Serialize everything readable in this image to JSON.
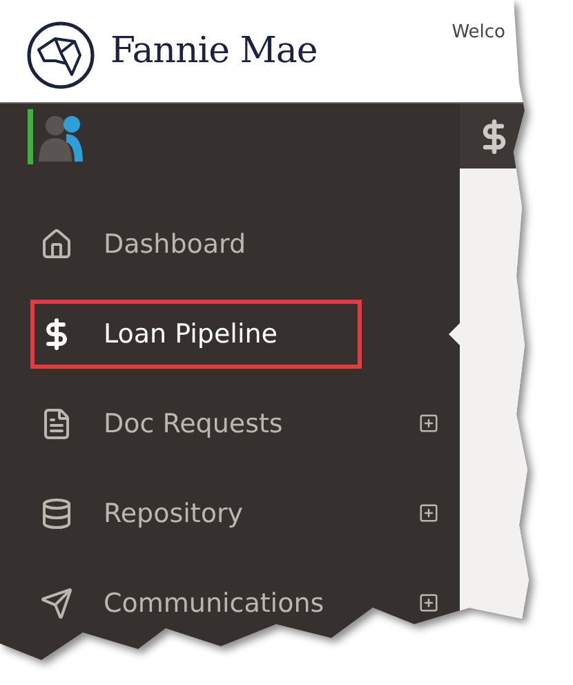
{
  "header": {
    "brand": "Fannie Mae",
    "welcome": "Welco"
  },
  "sidebar": {
    "user_status_on": true,
    "items": [
      {
        "label": "Dashboard",
        "kind": "home",
        "selected": false,
        "expandable": false
      },
      {
        "label": "Loan Pipeline",
        "kind": "dollar",
        "selected": true,
        "expandable": false
      },
      {
        "label": "Doc Requests",
        "kind": "document",
        "selected": false,
        "expandable": true
      },
      {
        "label": "Repository",
        "kind": "database",
        "selected": false,
        "expandable": true
      },
      {
        "label": "Communications",
        "kind": "send",
        "selected": false,
        "expandable": true
      }
    ]
  }
}
